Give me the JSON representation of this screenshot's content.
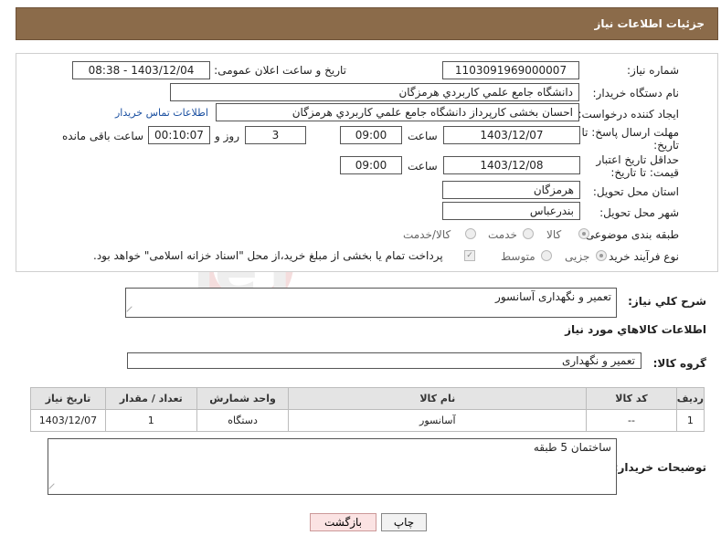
{
  "header": {
    "title": "جزئیات اطلاعات نیاز"
  },
  "fields": {
    "need_number_label": "شماره نیاز:",
    "need_number": "1103091969000007",
    "announce_label": "تاریخ و ساعت اعلان عمومی:",
    "announce_value": "1403/12/04 - 08:38",
    "buyer_org_label": "نام دستگاه خریدار:",
    "buyer_org": "دانشگاه جامع علمي كاربردي هرمزگان",
    "creator_label": "ایجاد کننده درخواست:",
    "creator": "احسان بخشی کارپرداز دانشگاه جامع علمي كاربردي هرمزگان",
    "contact_link": "اطلاعات تماس خریدار",
    "reply_deadline_label": "مهلت ارسال پاسخ: تا تاریخ:",
    "reply_date": "1403/12/07",
    "hour_label": "ساعت",
    "reply_time": "09:00",
    "days_value": "3",
    "days_label": "روز و",
    "remaining_time": "00:10:07",
    "remaining_label": "ساعت باقی مانده",
    "price_validity_label": "حداقل تاریخ اعتبار قیمت: تا تاریخ:",
    "price_date": "1403/12/08",
    "price_time": "09:00",
    "province_label": "استان محل تحویل:",
    "province": "هرمزگان",
    "city_label": "شهر محل تحویل:",
    "city": "بندرعباس",
    "category_label": "طبقه بندی موضوعی:",
    "category_options": [
      "کالا",
      "خدمت",
      "کالا/خدمت"
    ],
    "process_label": "نوع فرآیند خرید :",
    "process_options": [
      "جزیی",
      "متوسط"
    ],
    "payment_note": "پرداخت تمام یا بخشی از مبلغ خرید،از محل \"اسناد خزانه اسلامی\" خواهد بود."
  },
  "summary": {
    "label": "شرح کلي نياز:",
    "value": "تعمیر و نگهداری آسانسور"
  },
  "goods_section": {
    "title": "اطلاعات کالاهاي مورد نياز",
    "group_label": "گروه کالا:",
    "group_value": "تعمیر و نگهداری",
    "columns": [
      "رديف",
      "کد کالا",
      "نام کالا",
      "واحد شمارش",
      "تعداد / مقدار",
      "تاريخ نياز"
    ],
    "rows": [
      [
        "1",
        "--",
        "آسانسور",
        "دستگاه",
        "1",
        "1403/12/07"
      ]
    ]
  },
  "buyer_notes": {
    "label": "توضیحات خریدار:",
    "value": "ساختمان 5 طبقه"
  },
  "buttons": {
    "print": "چاپ",
    "back": "بازگشت"
  },
  "watermark": "AriaTender.neT",
  "colors": {
    "header": "#8b6b4a",
    "table_header": "#e4e4e4",
    "back_button": "#fbe3e3"
  }
}
